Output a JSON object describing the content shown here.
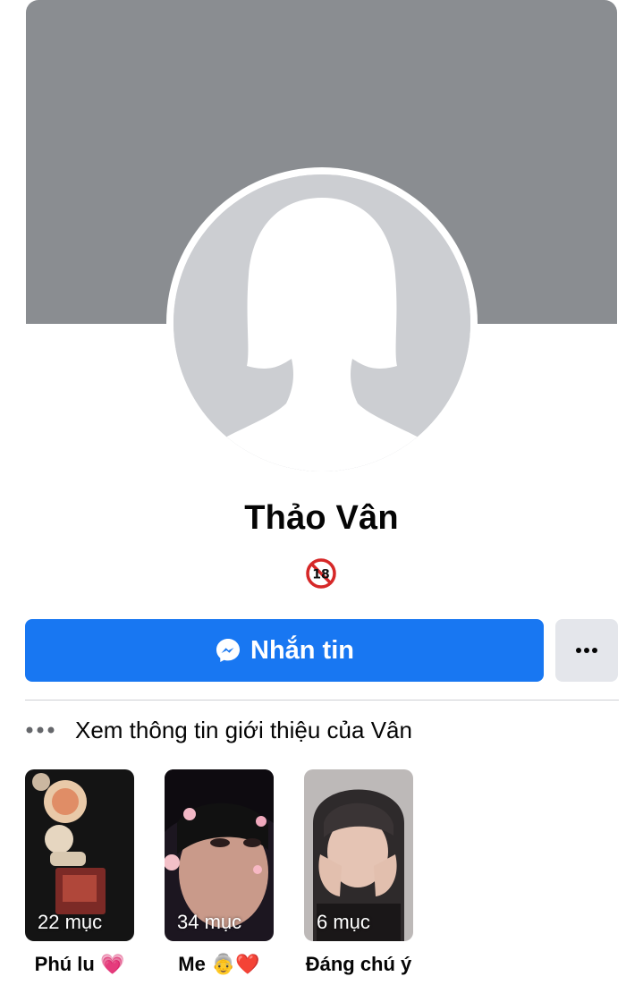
{
  "profile": {
    "name": "Thảo Vân",
    "badge_icon": "18-plus-icon"
  },
  "actions": {
    "message_label": "Nhắn tin",
    "message_icon": "messenger-icon",
    "more_icon": "more-horizontal-icon"
  },
  "about": {
    "label": "Xem thông tin giới thiệu của Vân",
    "icon": "more-dots-icon"
  },
  "highlights": [
    {
      "count": "22 mục",
      "label": "Phú lu 💗"
    },
    {
      "count": "34 mục",
      "label": "Me 👵❤️"
    },
    {
      "count": "6 mục",
      "label": "Đáng chú ý"
    }
  ],
  "colors": {
    "primary": "#1877f2",
    "cover": "#8a8d91",
    "avatar_bg": "#ccced2",
    "secondary_button": "#e4e6eb"
  }
}
